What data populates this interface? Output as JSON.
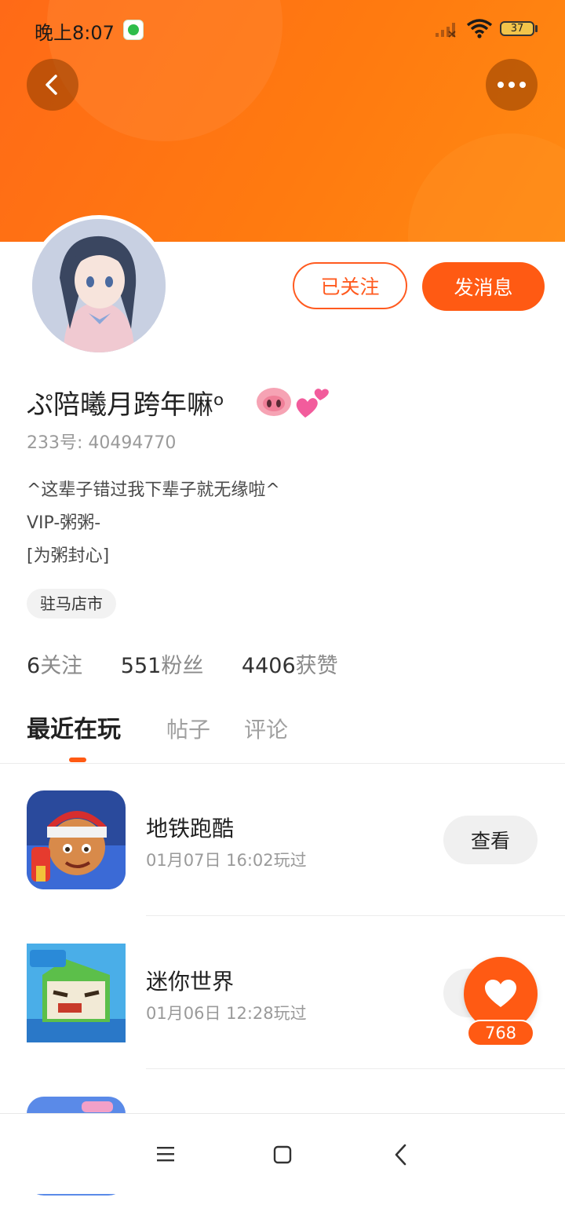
{
  "status_bar": {
    "time": "晚上8:07",
    "battery": "37"
  },
  "profile": {
    "nickname": "ぷ陪曦月跨年嘛ᵒ",
    "user_id": "233号: 40494770",
    "bio_lines": [
      "^这辈子错过我下辈子就无缘啦^",
      "VIP-粥粥-",
      "[为粥封心]"
    ],
    "location": "驻马店市",
    "follow_button": "已关注",
    "message_button": "发消息"
  },
  "stats": [
    {
      "num": "6",
      "label": "关注"
    },
    {
      "num": "551",
      "label": "粉丝"
    },
    {
      "num": "4406",
      "label": "获赞"
    }
  ],
  "tabs": [
    "最近在玩",
    "帖子",
    "评论"
  ],
  "games": [
    {
      "name": "地铁跑酷",
      "time": "01月07日 16:02玩过",
      "button": "查看"
    },
    {
      "name": "迷你世界",
      "time": "01月06日 12:28玩过",
      "button": ""
    }
  ],
  "like": {
    "count": "768"
  },
  "colors": {
    "accent": "#ff5a13",
    "header_gradient_start": "#ff6a17",
    "header_gradient_end": "#ff8a12"
  },
  "icons": [
    "back-arrow-icon",
    "more-dots-icon",
    "heart-icon",
    "menu-icon",
    "home-icon",
    "nav-back-icon",
    "wifi-icon",
    "signal-icon",
    "battery-icon"
  ]
}
